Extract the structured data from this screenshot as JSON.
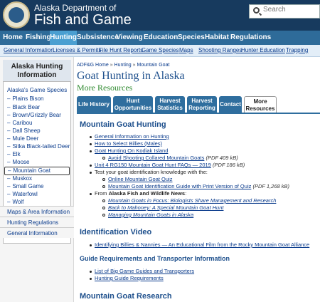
{
  "header": {
    "brand_line1": "Alaska Department of",
    "brand_line2": "Fish and Game",
    "search_placeholder": "Search"
  },
  "mainnav": [
    "Home",
    "Fishing",
    "Hunting",
    "Subsistence",
    "Viewing",
    "Education",
    "Species",
    "Habitat",
    "Regulations"
  ],
  "subnav": [
    "General Information",
    "Licenses & Permits",
    "File Hunt Reports",
    "Game Species",
    "Maps",
    "Shooting Ranges",
    "Hunter Education",
    "Trapping"
  ],
  "sidebar": {
    "heading": "Alaska Hunting Information",
    "section": "Alaska's Game Species",
    "items": [
      "Plains Bison",
      "Black Bear",
      "Brown/Grizzly Bear",
      "Caribou",
      "Dall Sheep",
      "Mule Deer",
      "Sitka Black-tailed Deer",
      "Elk",
      "Moose",
      "Mountain Goat",
      "Muskox",
      "Small Game",
      "Waterfowl",
      "Wolf"
    ],
    "bottom": [
      "Maps & Area Information",
      "Hunting Regulations",
      "General Information"
    ]
  },
  "breadcrumb": [
    "ADF&G Home",
    "Hunting",
    "Mountain Goat"
  ],
  "title": "Goat Hunting in Alaska",
  "subtitle": "More Resources",
  "tabs": [
    "Life History",
    "Hunt Opportunities",
    "Harvest Statistics",
    "Harvest Reporting",
    "Contact",
    "More Resources"
  ],
  "sections": {
    "goat_hunting": "Mountain Goat Hunting",
    "links": {
      "general": "General Information on Hunting",
      "select": "How to Select Billies (Males)",
      "kodiak": "Goat Hunting On Kodiak Island",
      "avoid": "Avoid Shooting Collared Mountain Goats",
      "avoid_note": "(PDF 409 kB)",
      "unit4": "Unit 4 RG150 Mountain Goat Hunt FAQs — 2019",
      "unit4_note": "(PDF 186 kB)",
      "test": "Test your goat identification knowledge with the:",
      "quiz": "Online Mountain Goat Quiz",
      "guide": "Mountain Goat Identification Guide with Print Version of Quiz",
      "guide_note": "(PDF 1,268 kB)",
      "from": "From ",
      "from_bold": "Alaska Fish and Wildlife News",
      "from_colon": ":",
      "news1": "Mountain Goats in Focus: Biologists Share Management and Research",
      "news2": "Back to Mahoney: A Special Mountain Goat Hunt",
      "news3": "Managing Mountain Goats in Alaska"
    },
    "video_heading": "Identification Video",
    "video_link": "Identifying Billies & Nannies — An Educational Film from the Rocky Mountain Goat Alliance",
    "guide_heading": "Guide Requirements and Transporter Information",
    "guide_links": [
      "List of Big Game Guides and Transporters",
      "Hunting Guide Requirements"
    ],
    "research_heading": "Mountain Goat Research"
  },
  "colors": {
    "header": "#173a5e",
    "nav": "#2e6b99",
    "nav_active": "#4a9fd1",
    "tab": "#2f6e9e",
    "link": "#0a3b8c",
    "title": "#1d4f8c",
    "subtitle": "#2f8a2f"
  }
}
